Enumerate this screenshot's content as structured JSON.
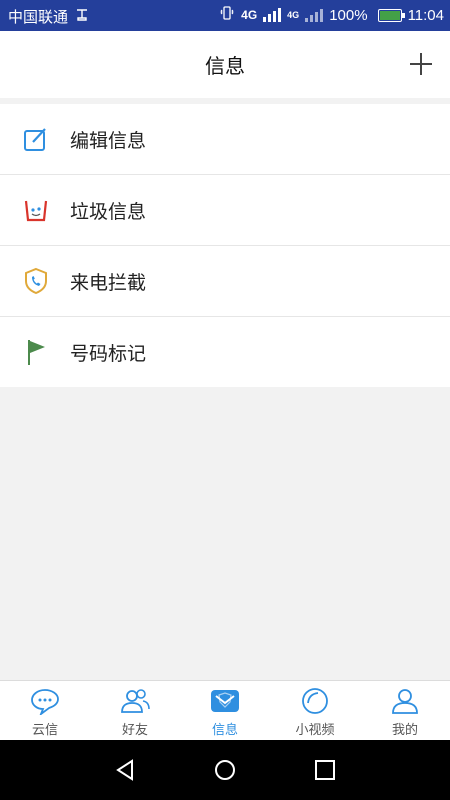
{
  "status": {
    "carrier": "中国联通",
    "network_4g_a": "4G",
    "network_4g_b": "4G",
    "battery": "100%",
    "time": "11:04"
  },
  "header": {
    "title": "信息"
  },
  "menu": [
    {
      "label": "编辑信息",
      "icon": "edit-icon"
    },
    {
      "label": "垃圾信息",
      "icon": "trash-icon"
    },
    {
      "label": "来电拦截",
      "icon": "shield-phone-icon"
    },
    {
      "label": "号码标记",
      "icon": "flag-icon"
    }
  ],
  "tabs": [
    {
      "label": "云信",
      "icon": "chat-bubble-icon"
    },
    {
      "label": "好友",
      "icon": "friends-icon"
    },
    {
      "label": "信息",
      "icon": "message-icon",
      "active": true
    },
    {
      "label": "小视频",
      "icon": "video-icon"
    },
    {
      "label": "我的",
      "icon": "profile-icon"
    }
  ],
  "colors": {
    "status_bg": "#243f9b",
    "accent": "#2f8fe0",
    "flag": "#4c8a4c",
    "trash_red": "#d9342b",
    "shield_gold": "#e0a93a"
  }
}
